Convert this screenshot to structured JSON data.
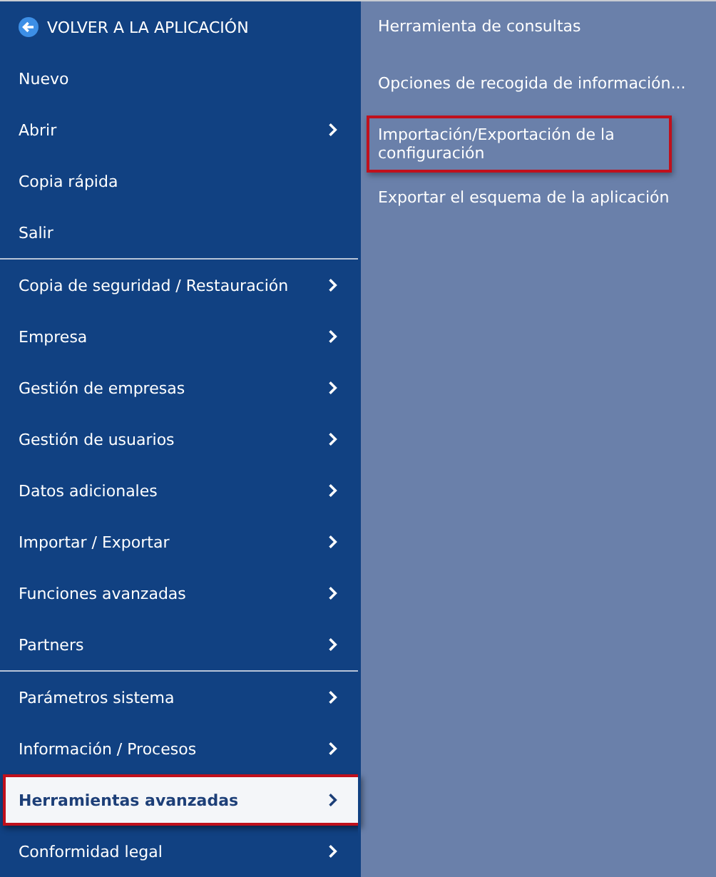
{
  "menu": {
    "groups": [
      {
        "items": [
          {
            "kind": "back",
            "label": "VOLVER A LA APLICACIÓN",
            "submenu": false,
            "selected": false
          },
          {
            "kind": "item",
            "label": "Nuevo",
            "submenu": false,
            "selected": false
          },
          {
            "kind": "item",
            "label": "Abrir",
            "submenu": true,
            "selected": false
          },
          {
            "kind": "item",
            "label": "Copia rápida",
            "submenu": false,
            "selected": false
          },
          {
            "kind": "item",
            "label": "Salir",
            "submenu": false,
            "selected": false
          }
        ]
      },
      {
        "items": [
          {
            "kind": "item",
            "label": "Copia de seguridad / Restauración",
            "submenu": true,
            "selected": false
          },
          {
            "kind": "item",
            "label": "Empresa",
            "submenu": true,
            "selected": false
          },
          {
            "kind": "item",
            "label": "Gestión de empresas",
            "submenu": true,
            "selected": false
          },
          {
            "kind": "item",
            "label": "Gestión de usuarios",
            "submenu": true,
            "selected": false
          },
          {
            "kind": "item",
            "label": "Datos adicionales",
            "submenu": true,
            "selected": false
          },
          {
            "kind": "item",
            "label": "Importar / Exportar",
            "submenu": true,
            "selected": false
          },
          {
            "kind": "item",
            "label": "Funciones avanzadas",
            "submenu": true,
            "selected": false
          },
          {
            "kind": "item",
            "label": "Partners",
            "submenu": true,
            "selected": false
          }
        ]
      },
      {
        "items": [
          {
            "kind": "item",
            "label": "Parámetros sistema",
            "submenu": true,
            "selected": false
          },
          {
            "kind": "item",
            "label": "Información / Procesos",
            "submenu": true,
            "selected": false
          },
          {
            "kind": "item",
            "label": "Herramientas avanzadas",
            "submenu": true,
            "selected": true
          },
          {
            "kind": "item",
            "label": "Conformidad legal",
            "submenu": true,
            "selected": false
          }
        ]
      }
    ]
  },
  "submenu": {
    "items": [
      {
        "label": "Herramienta de consultas",
        "outlined": false
      },
      {
        "label": "Opciones de recogida de información...",
        "outlined": false
      },
      {
        "label": "Importación/Exportación de la configuración",
        "outlined": true
      },
      {
        "label": "Exportar el esquema de la aplicación",
        "outlined": false
      }
    ]
  }
}
